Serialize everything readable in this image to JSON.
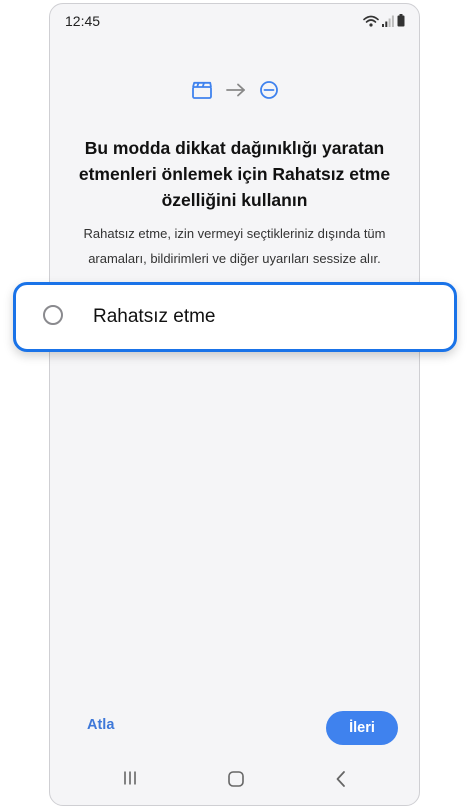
{
  "status_bar": {
    "time": "12:45",
    "icons": [
      "wifi-icon",
      "signal-icon",
      "battery-icon"
    ]
  },
  "hero": {
    "icons": [
      "clapperboard-icon",
      "arrow-right-icon",
      "do-not-disturb-icon"
    ]
  },
  "title": "Bu modda dikkat dağınıklığı yaratan etmenleri önlemek için Rahatsız etme özelliğini kullanın",
  "description": "Rahatsız etme, izin vermeyi seçtikleriniz dışında tüm aramaları, bildirimleri ve diğer uyarıları sessize alır.",
  "option": {
    "label": "Rahatsız etme",
    "selected": false
  },
  "footer": {
    "skip_label": "Atla",
    "next_label": "İleri"
  },
  "navbar": {
    "icons": [
      "recent-apps-icon",
      "home-icon",
      "back-icon"
    ]
  },
  "colors": {
    "accent": "#3f82ee",
    "highlight_border": "#1a73e8",
    "background": "#f5f5f7"
  }
}
